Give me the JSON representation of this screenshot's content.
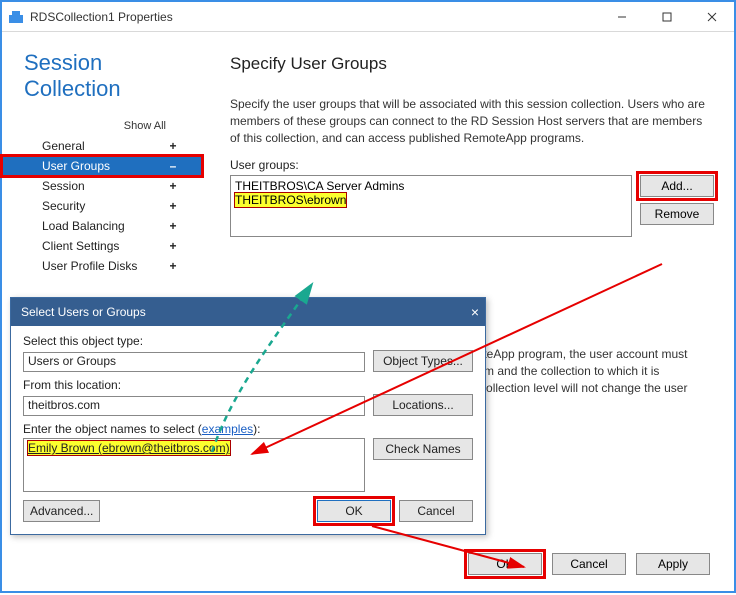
{
  "window": {
    "title": "RDSCollection1 Properties",
    "controls": {
      "min": "minimize",
      "max": "maximize",
      "close": "close"
    }
  },
  "heading": "Session Collection",
  "show_all": "Show All",
  "nav": [
    {
      "label": "General",
      "sign": "+",
      "selected": false
    },
    {
      "label": "User Groups",
      "sign": "–",
      "selected": true
    },
    {
      "label": "Session",
      "sign": "+",
      "selected": false
    },
    {
      "label": "Security",
      "sign": "+",
      "selected": false
    },
    {
      "label": "Load Balancing",
      "sign": "+",
      "selected": false
    },
    {
      "label": "Client Settings",
      "sign": "+",
      "selected": false
    },
    {
      "label": "User Profile Disks",
      "sign": "+",
      "selected": false
    }
  ],
  "content": {
    "title": "Specify User Groups",
    "desc": "Specify the user groups that will be associated with this session collection. Users who are members of these groups can connect to the RD Session Host servers that are members of this collection, and can access published RemoteApp programs.",
    "list_label": "User groups:",
    "list": [
      "THEITBROS\\CA Server Admins",
      "THEITBROS\\ebrown"
    ],
    "add_btn": "Add...",
    "remove_btn": "Remove",
    "note_partial": "…emoteApp program, the user account must … ogram and the collection to which it is … the collection level will not change the user …"
  },
  "bottom": {
    "ok": "OK",
    "cancel": "Cancel",
    "apply": "Apply"
  },
  "dialog": {
    "title": "Select Users or Groups",
    "obj_type_label": "Select this object type:",
    "obj_type_value": "Users or Groups",
    "obj_types_btn": "Object Types...",
    "from_loc_label": "From this location:",
    "from_loc_value": "theitbros.com",
    "locations_btn": "Locations...",
    "names_label_prefix": "Enter the object names to select (",
    "names_label_link": "examples",
    "names_label_suffix": "):",
    "names_value": "Emily Brown (ebrown@theitbros.com)",
    "check_btn": "Check Names",
    "advanced_btn": "Advanced...",
    "ok": "OK",
    "cancel": "Cancel"
  }
}
